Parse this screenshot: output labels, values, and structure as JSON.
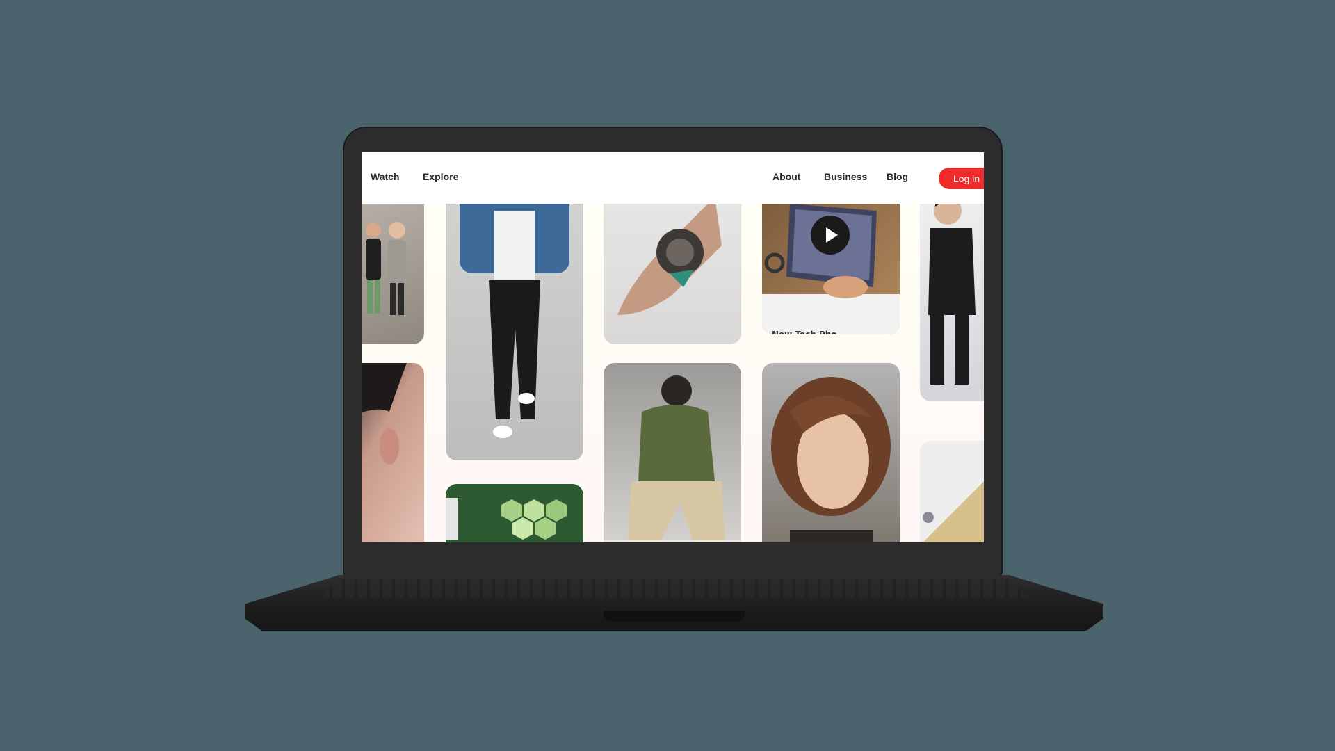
{
  "nav": {
    "watch": "Watch",
    "explore": "Explore",
    "about": "About",
    "business": "Business",
    "blog": "Blog",
    "login": "Log in"
  },
  "pins": [
    {
      "id": "pin-animated-trio",
      "icon": "photo-icon"
    },
    {
      "id": "pin-denim-outfit",
      "icon": "photo-icon"
    },
    {
      "id": "pin-hand-tattoo",
      "icon": "photo-icon"
    },
    {
      "id": "pin-foldable-phone-video",
      "icon": "play-icon",
      "caption": "New Tech Pho"
    },
    {
      "id": "pin-animated-figure",
      "icon": "photo-icon"
    },
    {
      "id": "pin-haircut",
      "icon": "photo-icon"
    },
    {
      "id": "pin-green-jacket",
      "icon": "photo-icon"
    },
    {
      "id": "pin-portrait",
      "icon": "photo-icon"
    },
    {
      "id": "pin-green-hexagons",
      "icon": "photo-icon"
    },
    {
      "id": "pin-beige-closeup",
      "icon": "photo-icon"
    }
  ],
  "colors": {
    "background": "#4b636c",
    "accent": "#ef2b2b",
    "nav_text": "#2b2b2b",
    "laptop_body": "#2c2c2c"
  }
}
